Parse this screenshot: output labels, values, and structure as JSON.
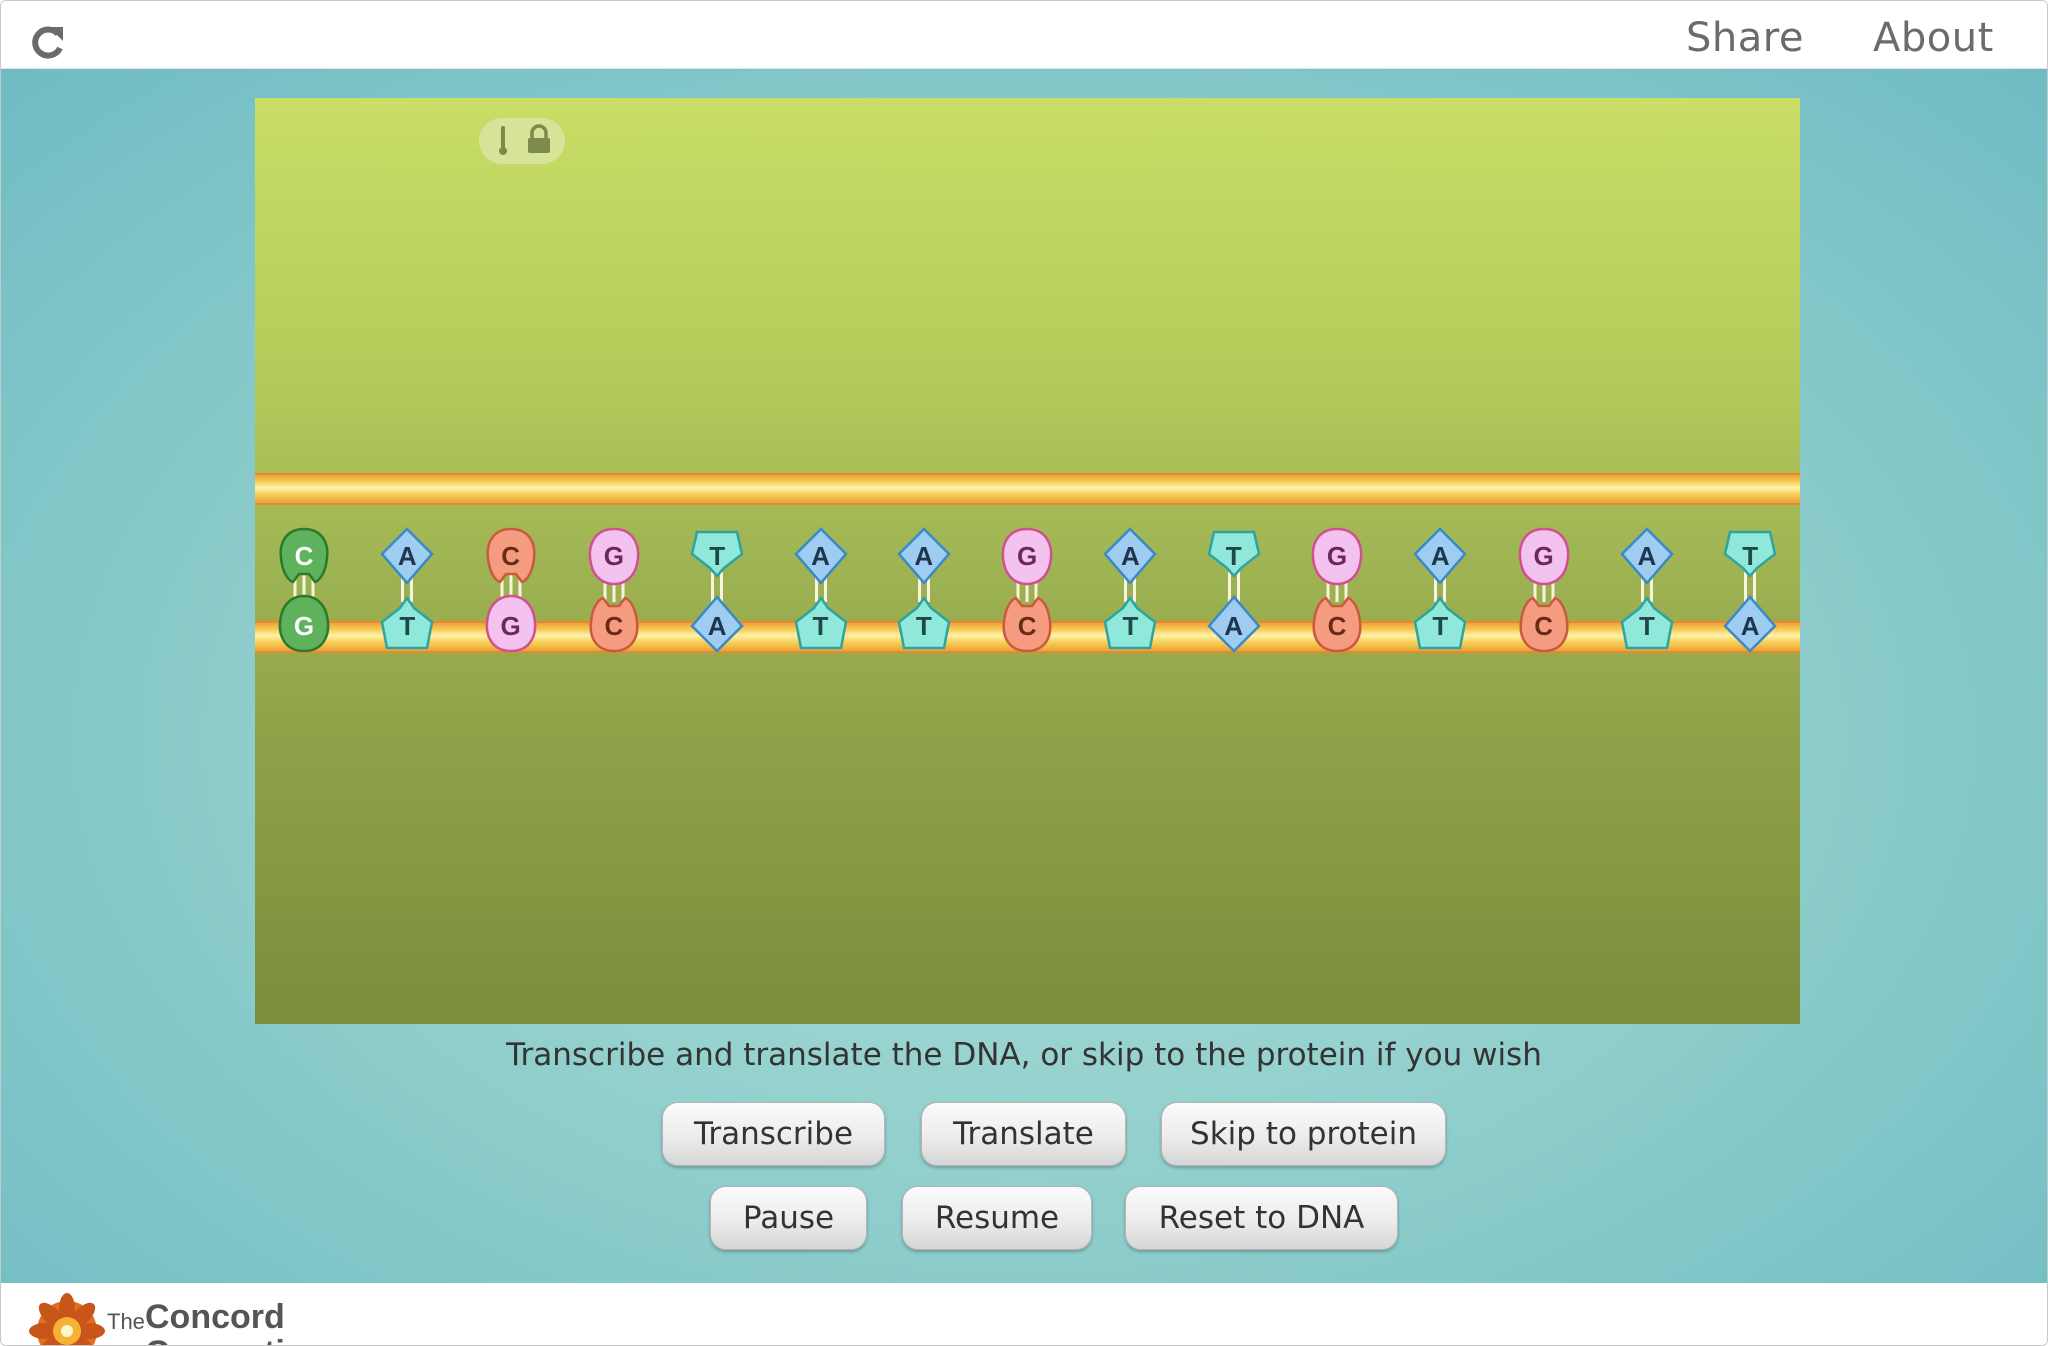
{
  "topbar": {
    "reload_icon": "reload-icon",
    "share_label": "Share",
    "about_label": "About"
  },
  "simulation": {
    "control_icons": [
      "thermometer-icon",
      "lock-icon"
    ],
    "colors": {
      "G": {
        "fill": "#f4c2ef",
        "stroke": "#d05090",
        "text": "#6b2a55"
      },
      "C": {
        "fill": "#f59b80",
        "stroke": "#c95a3e",
        "text": "#6a2a18"
      },
      "A": {
        "fill": "#9fcdf2",
        "stroke": "#3a8ac6",
        "text": "#1f3550"
      },
      "T": {
        "fill": "#8fe8d9",
        "stroke": "#2ea3a0",
        "text": "#1f4848"
      },
      "first_pair": {
        "fill": "#5fb25c",
        "stroke": "#2a7a2b",
        "text": "#ffffff"
      }
    },
    "dna": {
      "top_strand": [
        "C",
        "A",
        "C",
        "G",
        "T",
        "A",
        "A",
        "G",
        "A",
        "T",
        "G",
        "A",
        "G",
        "A",
        "T"
      ],
      "bottom_strand": [
        "G",
        "T",
        "G",
        "C",
        "A",
        "T",
        "T",
        "C",
        "T",
        "A",
        "C",
        "T",
        "C",
        "T",
        "A"
      ]
    }
  },
  "instruction": "Transcribe and translate the DNA, or skip to the protein if you wish",
  "buttons": {
    "transcribe": "Transcribe",
    "translate": "Translate",
    "skip_to_protein": "Skip to protein",
    "pause": "Pause",
    "resume": "Resume",
    "reset_to_dna": "Reset to DNA"
  },
  "footer": {
    "logo_the": "The",
    "logo_name": "Concord",
    "logo_name_2": "Consortium"
  }
}
